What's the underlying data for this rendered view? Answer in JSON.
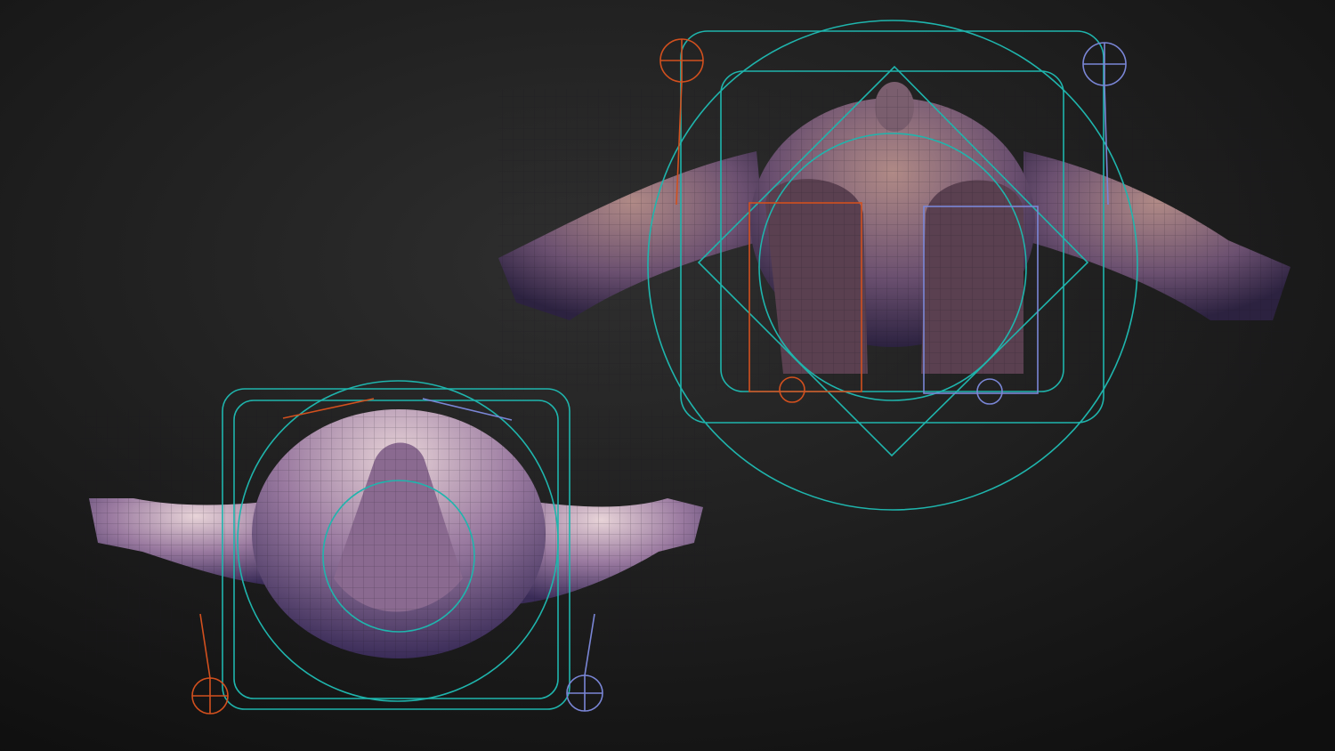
{
  "scene": {
    "description_label": "",
    "colors": {
      "background_center": "#2e2e2e",
      "background_edge": "#101010",
      "control_main": "#1fb5ad",
      "control_left": "#d2501e",
      "control_right": "#7a86d6",
      "skin_light": "#c9a0a8",
      "skin_shadow": "#3a2c52"
    },
    "figures": [
      "top-down-view",
      "bottom-up-view"
    ]
  }
}
